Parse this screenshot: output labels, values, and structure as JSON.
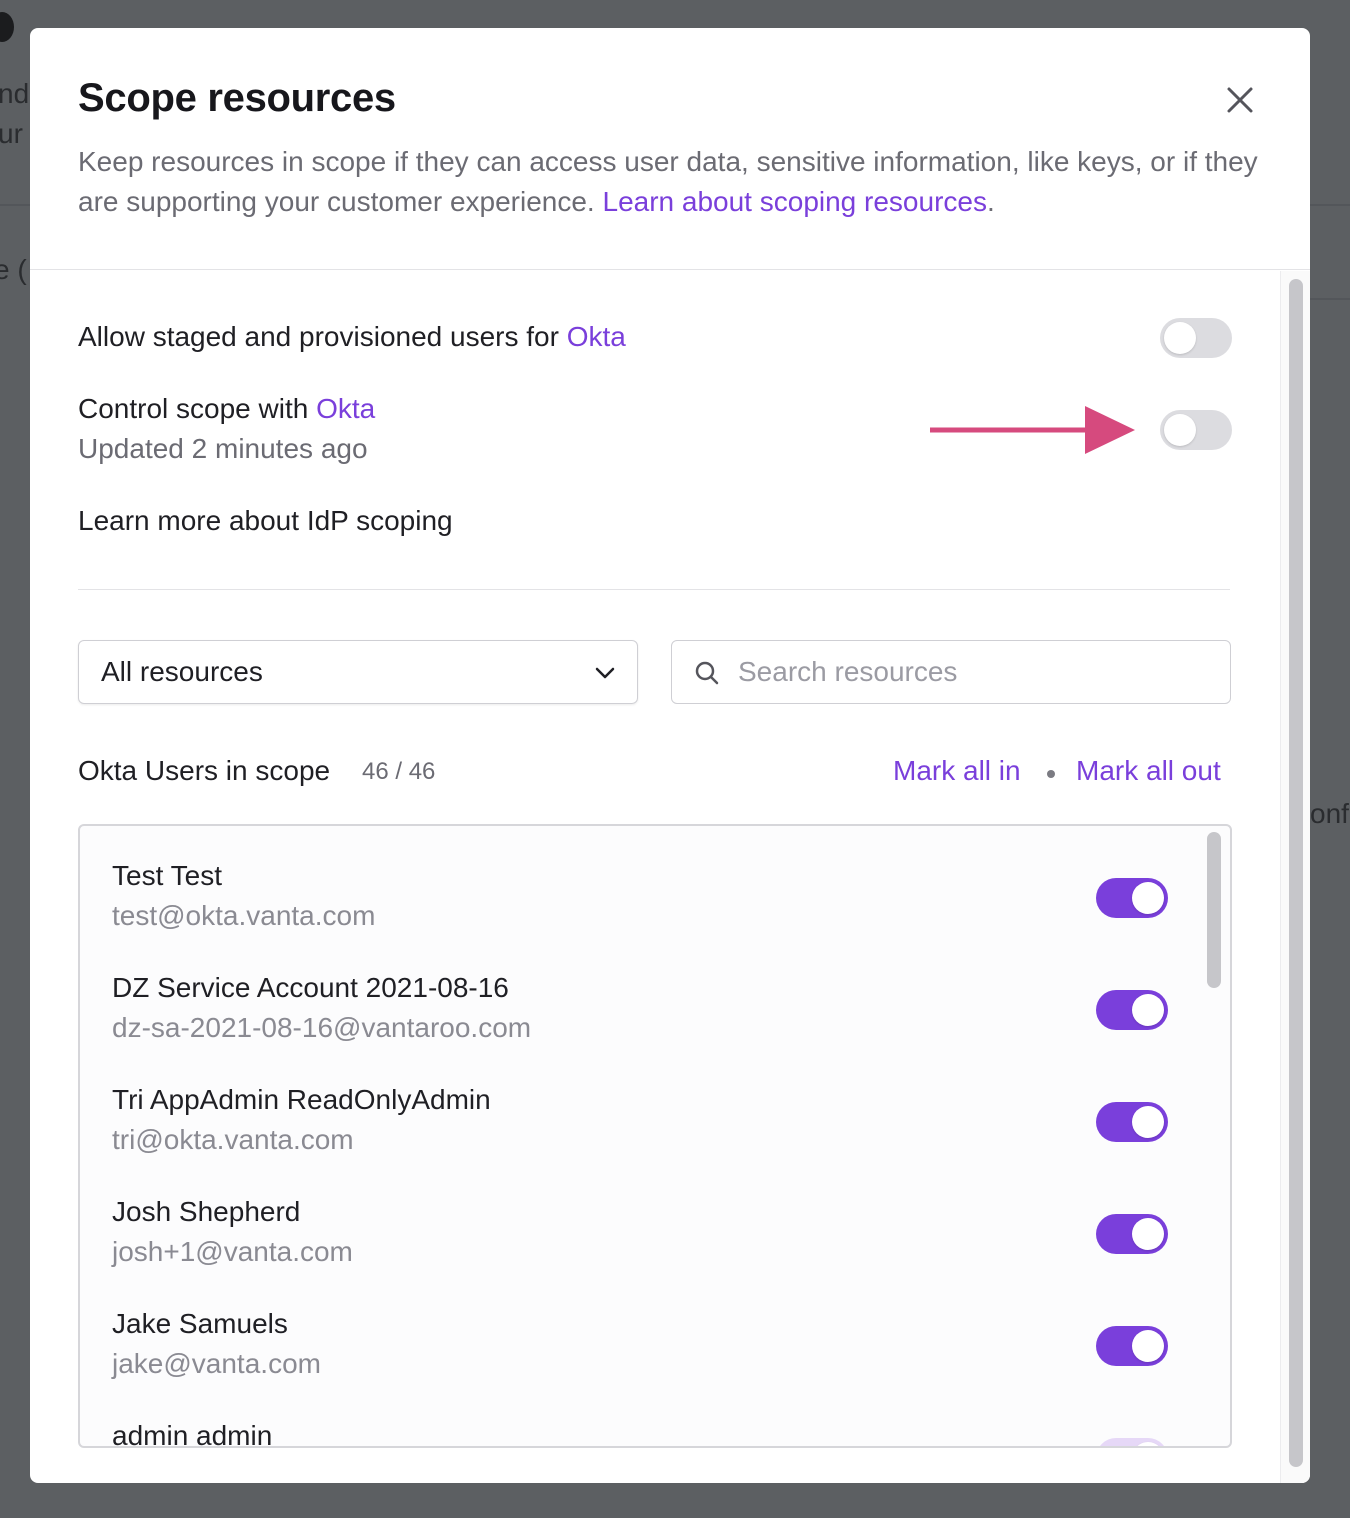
{
  "background": {
    "fragments": [
      "nd",
      "ur",
      "e (",
      "onf"
    ]
  },
  "modal": {
    "title": "Scope resources",
    "description": "Keep resources in scope if they can access user data, sensitive information, like keys, or if they are supporting your customer experience.",
    "description_link": "Learn about scoping resources",
    "description_end": "."
  },
  "settings": {
    "staged": {
      "label": "Allow staged and provisioned users for",
      "provider": "Okta",
      "enabled": false
    },
    "control_scope": {
      "label": "Control scope with",
      "provider": "Okta",
      "updated": "Updated 2 minutes ago",
      "enabled": false
    },
    "learn_more": "Learn more about IdP scoping"
  },
  "filters": {
    "resource_type": "All resources",
    "search_placeholder": "Search resources"
  },
  "list": {
    "heading": "Okta Users in scope",
    "count": "46 / 46",
    "mark_all_in": "Mark all in",
    "mark_all_out": "Mark all out",
    "users": [
      {
        "name": "Test Test",
        "email": "test@okta.vanta.com",
        "in_scope": true
      },
      {
        "name": "DZ Service Account 2021-08-16",
        "email": "dz-sa-2021-08-16@vantaroo.com",
        "in_scope": true
      },
      {
        "name": "Tri AppAdmin ReadOnlyAdmin",
        "email": "tri@okta.vanta.com",
        "in_scope": true
      },
      {
        "name": "Josh Shepherd",
        "email": "josh+1@vanta.com",
        "in_scope": true
      },
      {
        "name": "Jake Samuels",
        "email": "jake@vanta.com",
        "in_scope": true
      },
      {
        "name": "admin admin",
        "email": "",
        "in_scope": true
      }
    ]
  },
  "colors": {
    "accent": "#7a3fdb",
    "annotation_arrow": "#d64a7e",
    "overlay": "#5c5f62"
  }
}
